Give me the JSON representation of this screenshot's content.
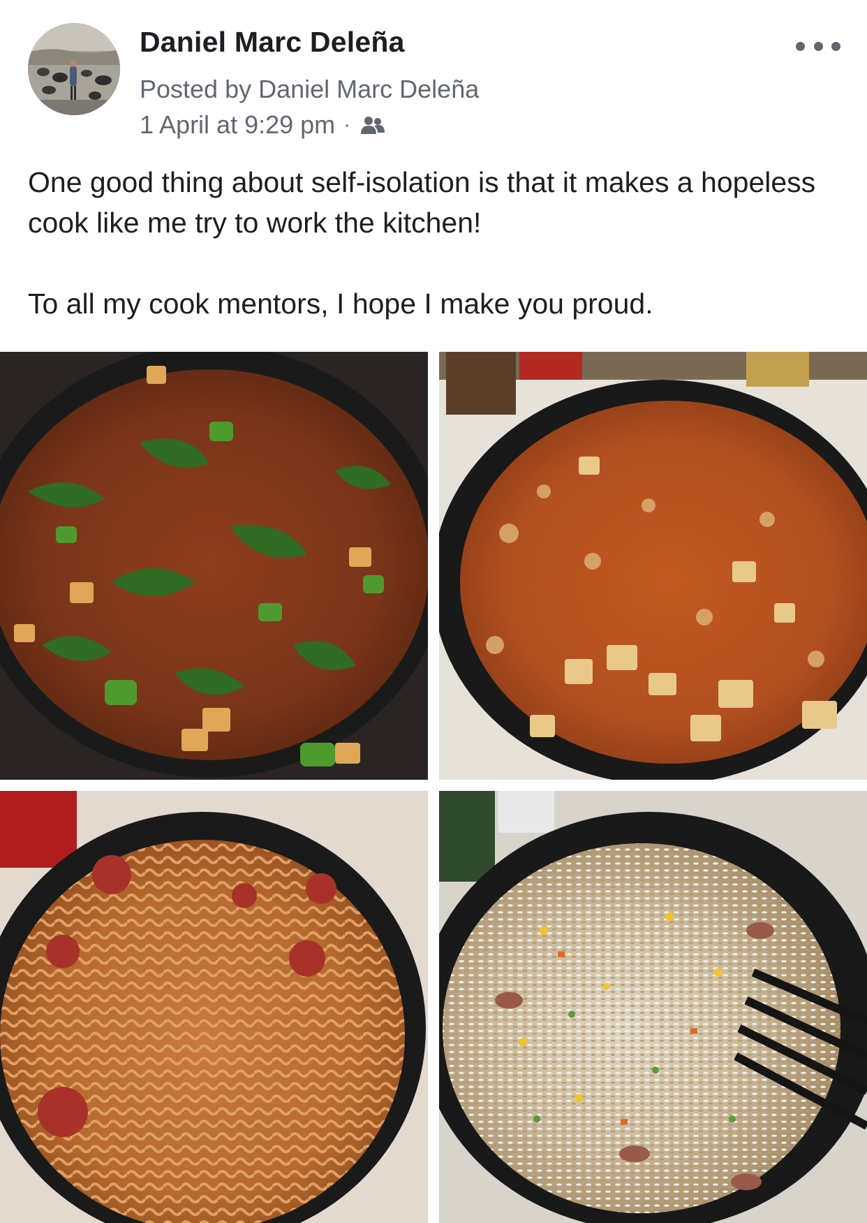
{
  "post": {
    "author_name": "Daniel Marc Deleña",
    "posted_by": "Posted by Daniel Marc Deleña",
    "timestamp": "1 April at 9:29 pm",
    "separator": "·",
    "audience_icon": "group-icon",
    "more_icon": "more-options-icon",
    "text_paragraphs": [
      "One good thing about self-isolation is that it makes a hopeless cook like me try to work the kitchen!",
      "To all my cook mentors, I hope I make you proud."
    ]
  },
  "photos": [
    {
      "subject": "pan of minced meat with spinach, peppers and potatoes"
    },
    {
      "subject": "pan of minced meat and potato stew in tomato sauce"
    },
    {
      "subject": "pan of fusilli pasta with sausage and tomato sauce"
    },
    {
      "subject": "pan of fried rice with vegetables and sausage"
    }
  ],
  "colors": {
    "text_primary": "#1c1e21",
    "text_secondary": "#606770",
    "background": "#ffffff"
  }
}
